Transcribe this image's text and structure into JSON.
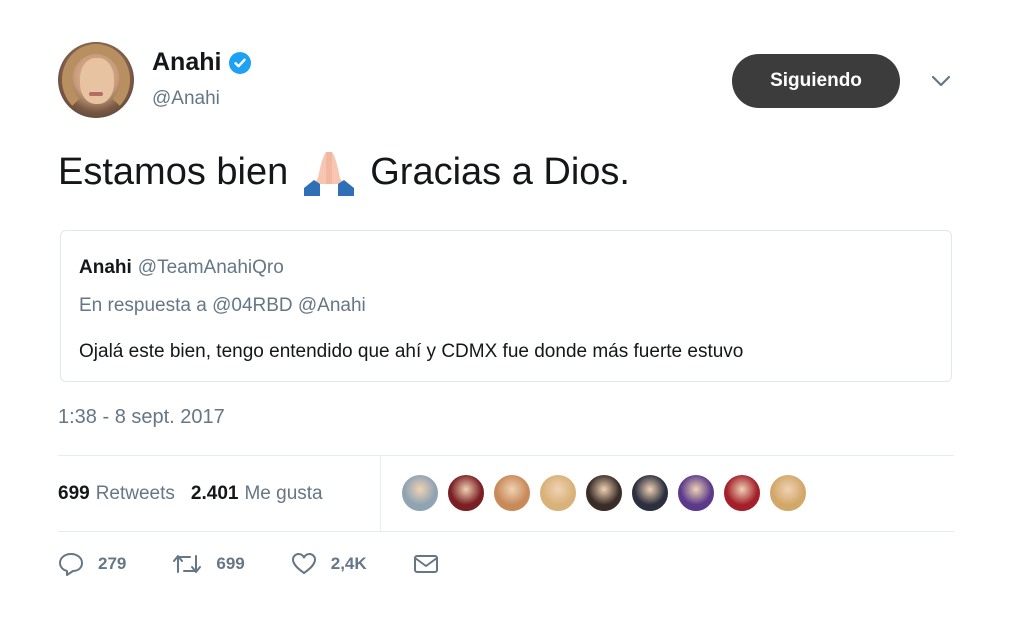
{
  "header": {
    "name": "Anahi",
    "handle": "@Anahi",
    "follow_label": "Siguiendo"
  },
  "tweet": {
    "text_before": "Estamos bien",
    "emoji_name": "folded-hands-emoji",
    "text_after": "Gracias a Dios."
  },
  "quote": {
    "name": "Anahi",
    "handle": "@TeamAnahiQro",
    "reply_to": "En respuesta a @04RBD @Anahi",
    "body": "Ojalá este bien, tengo entendido que ahí y CDMX fue donde más fuerte estuvo"
  },
  "timestamp": "1:38 - 8 sept. 2017",
  "stats": {
    "retweets_count": "699",
    "retweets_label": "Retweets",
    "likes_count": "2.401",
    "likes_label": "Me gusta"
  },
  "likers": [
    {
      "color": "#8fa3b3"
    },
    {
      "color": "#7a1f24"
    },
    {
      "color": "#c98a5a"
    },
    {
      "color": "#d9b27a"
    },
    {
      "color": "#3a2d28"
    },
    {
      "color": "#2b2f3f"
    },
    {
      "color": "#5b3a8a"
    },
    {
      "color": "#a3202b"
    },
    {
      "color": "#d2a86a"
    }
  ],
  "actions": {
    "reply_count": "279",
    "retweet_count": "699",
    "like_count": "2,4K"
  },
  "icons": {
    "verified": "verified-badge-icon",
    "chevron": "chevron-down-icon",
    "reply": "reply-icon",
    "retweet": "retweet-icon",
    "like": "heart-icon",
    "message": "envelope-icon"
  },
  "colors": {
    "accent": "#1da1f2",
    "follow_button": "#3c3c3c",
    "secondary_text": "#657786"
  }
}
